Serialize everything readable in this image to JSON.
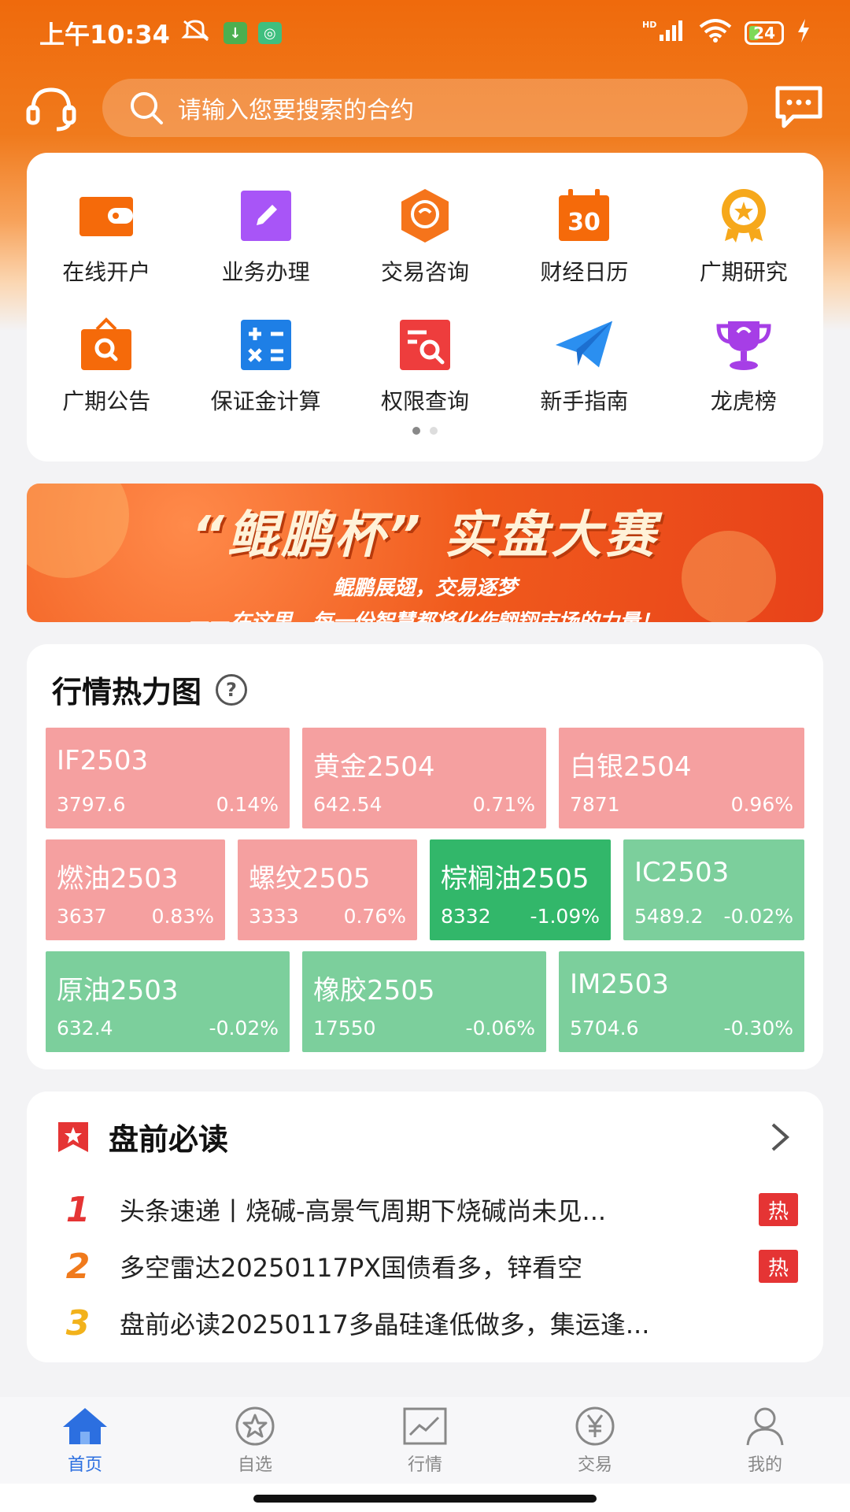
{
  "status_bar": {
    "time": "上午10:34",
    "network": "HD",
    "battery": "24"
  },
  "header": {
    "search_placeholder": "请输入您要搜索的合约"
  },
  "shortcuts": [
    {
      "label": "在线开户",
      "icon": "wallet-icon"
    },
    {
      "label": "业务办理",
      "icon": "edit-icon"
    },
    {
      "label": "交易咨询",
      "icon": "consult-icon"
    },
    {
      "label": "财经日历",
      "icon": "calendar-icon"
    },
    {
      "label": "广期研究",
      "icon": "research-badge-icon"
    },
    {
      "label": "广期公告",
      "icon": "announcement-icon"
    },
    {
      "label": "保证金计算",
      "icon": "calculator-icon"
    },
    {
      "label": "权限查询",
      "icon": "permission-search-icon"
    },
    {
      "label": "新手指南",
      "icon": "paper-plane-icon"
    },
    {
      "label": "龙虎榜",
      "icon": "trophy-icon"
    }
  ],
  "calendar_day": "30",
  "banner": {
    "title": "“鲲鹏杯” 实盘大赛",
    "subtitle": "鲲鹏展翅，交易逐梦",
    "tagline": "——在这里，每一份智慧都将化作翱翔市场的力量！"
  },
  "heatmap": {
    "title": "行情热力图",
    "help": "?",
    "tiles": [
      {
        "name": "IF2503",
        "price": "3797.6",
        "change": "0.14%"
      },
      {
        "name": "黄金2504",
        "price": "642.54",
        "change": "0.71%"
      },
      {
        "name": "白银2504",
        "price": "7871",
        "change": "0.96%"
      },
      {
        "name": "燃油2503",
        "price": "3637",
        "change": "0.83%"
      },
      {
        "name": "螺纹2505",
        "price": "3333",
        "change": "0.76%"
      },
      {
        "name": "棕榈油2505",
        "price": "8332",
        "change": "-1.09%"
      },
      {
        "name": "IC2503",
        "price": "5489.2",
        "change": "-0.02%"
      },
      {
        "name": "原油2503",
        "price": "632.4",
        "change": "-0.02%"
      },
      {
        "name": "橡胶2505",
        "price": "17550",
        "change": "-0.06%"
      },
      {
        "name": "IM2503",
        "price": "5704.6",
        "change": "-0.30%"
      }
    ]
  },
  "must_read": {
    "title": "盘前必读",
    "items": [
      {
        "rank": "1",
        "text": "头条速递丨烧碱-高景气周期下烧碱尚未见...",
        "badge": "热",
        "color": "#e53434"
      },
      {
        "rank": "2",
        "text": "多空雷达20250117PX国债看多，锌看空",
        "badge": "热",
        "color": "#f07a1c"
      },
      {
        "rank": "3",
        "text": "盘前必读20250117多晶硅逢低做多，集运逢...",
        "badge": "",
        "color": "#f2b21b"
      }
    ]
  },
  "tabs": [
    {
      "label": "首页",
      "icon": "home-icon",
      "active": true
    },
    {
      "label": "自选",
      "icon": "favorite-star-icon",
      "active": false
    },
    {
      "label": "行情",
      "icon": "market-chart-icon",
      "active": false
    },
    {
      "label": "交易",
      "icon": "yuan-trade-icon",
      "active": false
    },
    {
      "label": "我的",
      "icon": "profile-icon",
      "active": false
    }
  ]
}
